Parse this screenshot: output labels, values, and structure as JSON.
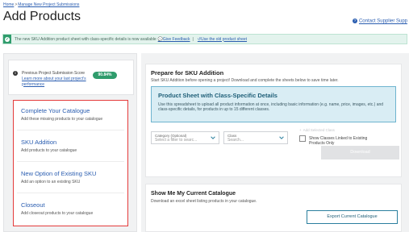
{
  "breadcrumb": {
    "home": "Home",
    "separator": ">",
    "current": "Manage New Project Submissions"
  },
  "page": {
    "title": "Add Products"
  },
  "header": {
    "contact_link": "Contact Supplier Supp"
  },
  "banner": {
    "message": "The new SKU Addition product sheet with class-specific details is now available",
    "feedback_link": "Give Feedback",
    "separator": "|",
    "old_sheet_link": "Use the old product sheet"
  },
  "score": {
    "label": "Previous Project Submission Score",
    "learn_more": "Learn more about your last project's performance",
    "value": "90.84%"
  },
  "options": [
    {
      "title": "Complete Your Catalogue",
      "desc": "Add these missing products to your catalogue"
    },
    {
      "title": "SKU Addition",
      "desc": "Add products to your catalogue"
    },
    {
      "title": "New Option of Existing SKU",
      "desc": "Add an option to an existing SKU"
    },
    {
      "title": "Closeout",
      "desc": "Add closeout products to your catalogue"
    }
  ],
  "prepare": {
    "title": "Prepare for SKU Addition",
    "subtitle": "Start SKU Addition before opening a project! Download and complete the sheets below to save time later.",
    "sheet_title": "Product Sheet with Class-Specific Details",
    "sheet_text": "Use this spreadsheet to upload all product information at once, including basic information (e.g. name, price, images, etc.) and class-specific details, for products in up to 15 different classes.",
    "category_label": "Category (Optional)",
    "category_placeholder": "Select a filter to searc...",
    "class_label": "Class",
    "class_placeholder": "Search...",
    "add_class": "Add Selected Class",
    "checkbox_label": "Show Classes Linked to Existing Products Only",
    "download": "Download"
  },
  "current_catalogue": {
    "title": "Show Me My Current Catalogue",
    "subtitle": "Download an excel sheet listing products in your catalogue.",
    "export_button": "Export Current Catalogue"
  },
  "colors": {
    "accent": "#2a5db0",
    "success": "#2f9c6c",
    "highlight": "#e43b3b"
  }
}
